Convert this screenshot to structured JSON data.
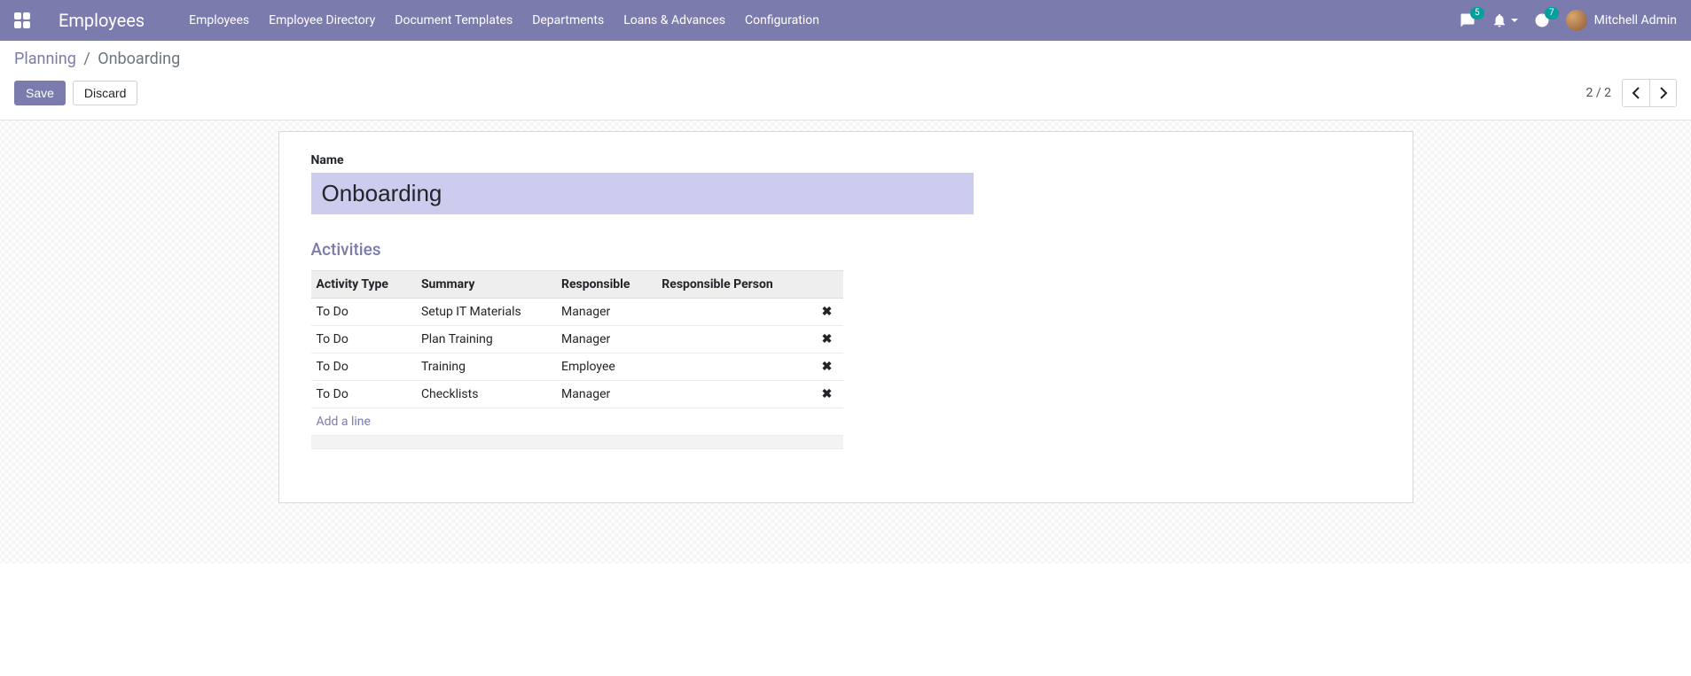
{
  "topbar": {
    "brand": "Employees",
    "nav": [
      "Employees",
      "Employee Directory",
      "Document Templates",
      "Departments",
      "Loans & Advances",
      "Configuration"
    ],
    "messages_badge": "5",
    "activities_badge": "7",
    "user_name": "Mitchell Admin"
  },
  "breadcrumb": {
    "parent": "Planning",
    "current": "Onboarding"
  },
  "buttons": {
    "save": "Save",
    "discard": "Discard"
  },
  "pager": {
    "text": "2 / 2"
  },
  "form": {
    "name_label": "Name",
    "name_value": "Onboarding",
    "section_title": "Activities",
    "add_line": "Add a line"
  },
  "table": {
    "headers": {
      "activity_type": "Activity Type",
      "summary": "Summary",
      "responsible": "Responsible",
      "responsible_person": "Responsible Person"
    },
    "rows": [
      {
        "activity_type": "To Do",
        "summary": "Setup IT Materials",
        "responsible": "Manager",
        "responsible_person": ""
      },
      {
        "activity_type": "To Do",
        "summary": "Plan Training",
        "responsible": "Manager",
        "responsible_person": ""
      },
      {
        "activity_type": "To Do",
        "summary": "Training",
        "responsible": "Employee",
        "responsible_person": ""
      },
      {
        "activity_type": "To Do",
        "summary": "Checklists",
        "responsible": "Manager",
        "responsible_person": ""
      }
    ]
  }
}
